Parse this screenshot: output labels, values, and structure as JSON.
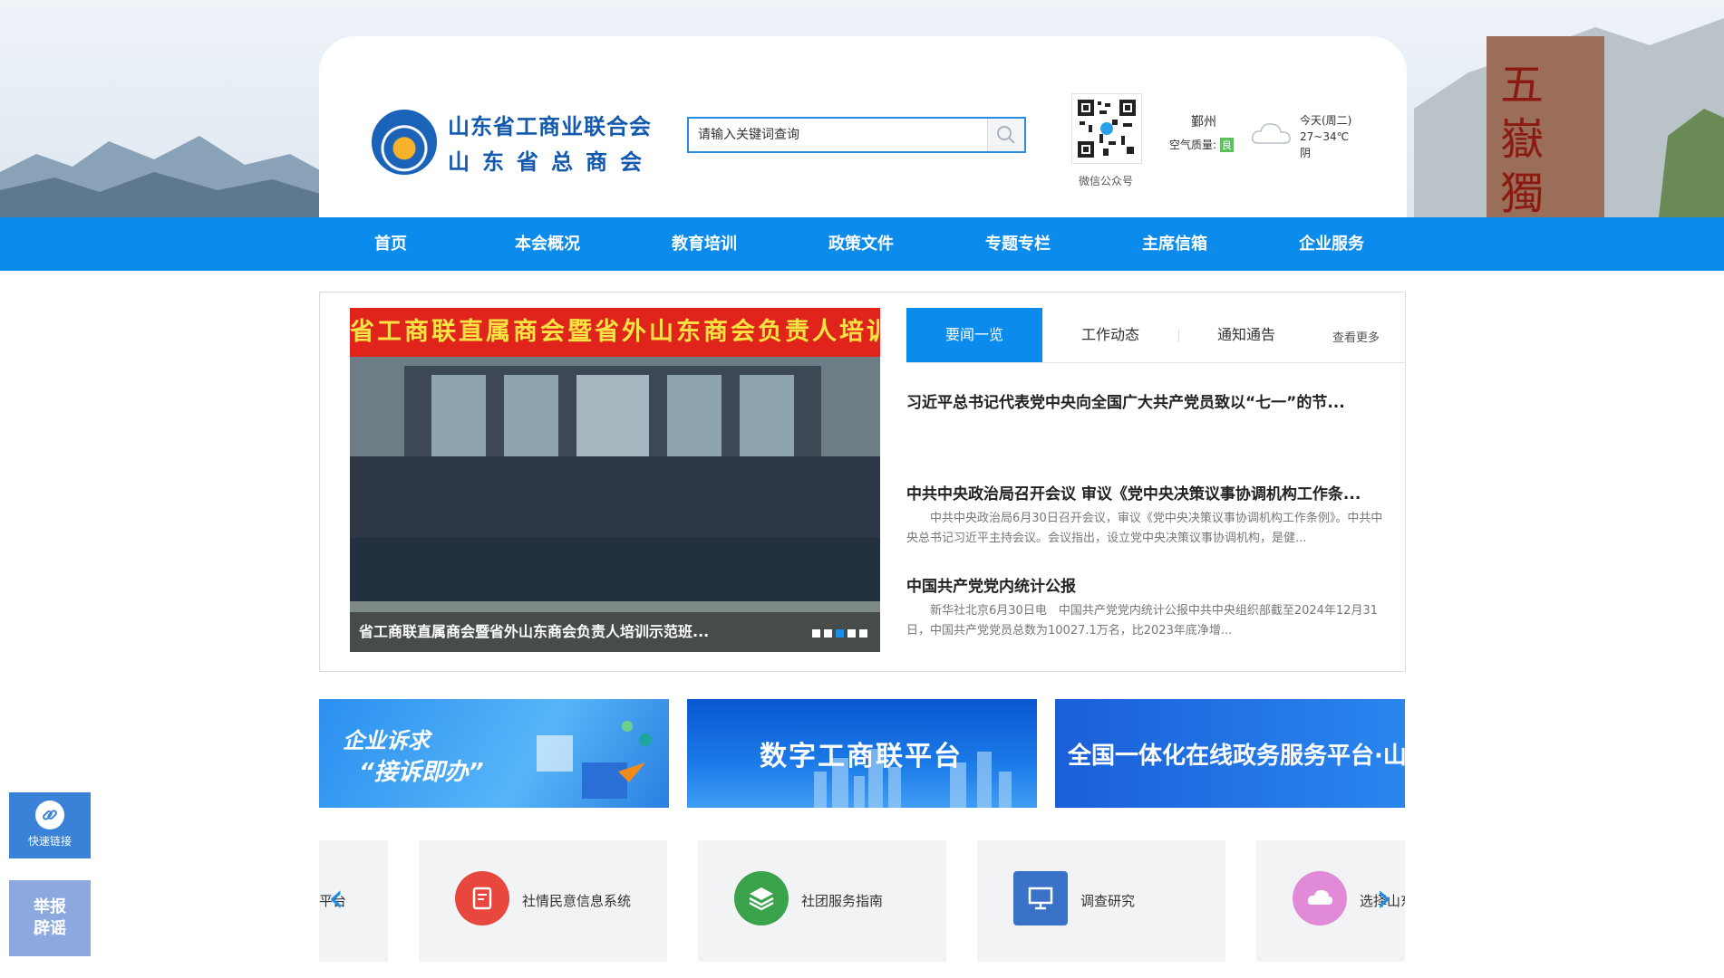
{
  "header": {
    "org_name_1": "山东省工商业联合会",
    "org_name_2": "山东省总商会",
    "search_placeholder": "请输入关键词查询",
    "qr_label": "微信公众号",
    "weather": {
      "city": "鄞州",
      "air_quality_label": "空气质量:",
      "air_quality_value": "良",
      "day": "今天(周二)",
      "temp": "27~34℃",
      "condition": "阴"
    }
  },
  "nav": {
    "items": [
      "首页",
      "本会概况",
      "教育培训",
      "政策文件",
      "专题专栏",
      "主席信箱",
      "企业服务"
    ]
  },
  "slider": {
    "banner_text": "省工商联直属商会暨省外山东商会负责人培训示",
    "caption": "省工商联直属商会暨省外山东商会负责人培训示范班..."
  },
  "tabs": {
    "items": [
      "要闻一览",
      "工作动态",
      "通知通告"
    ],
    "more": "查看更多"
  },
  "news": [
    {
      "title": "习近平总书记代表党中央向全国广大共产党员致以“七一”的节...",
      "summary": ""
    },
    {
      "title": "中共中央政治局召开会议 审议《党中央决策议事协调机构工作条...",
      "summary": "中共中央政治局6月30日召开会议，审议《党中央决策议事协调机构工作条例》。中共中央总书记习近平主持会议。会议指出，设立党中央决策议事协调机构，是健..."
    },
    {
      "title": "中国共产党党内统计公报",
      "summary": "新华社北京6月30日电　中国共产党党内统计公报中共中央组织部截至2024年12月31日，中国共产党党员总数为10027.1万名，比2023年底净增..."
    }
  ],
  "banners": {
    "b1_line1": "企业诉求",
    "b1_line2": "“接诉即办”",
    "b2": "数字工商联平台",
    "b3": "全国一体化在线政务服务平台·山东"
  },
  "services": {
    "partial_left": "平台",
    "items": [
      "社情民意信息系统",
      "社团服务指南",
      "调查研究"
    ],
    "partial_right": "选择山东"
  },
  "side": {
    "quick_link": "快速链接",
    "report_line1": "举报",
    "report_line2": "辟谣"
  },
  "colors": {
    "primary": "#0b8cec",
    "logo_blue": "#1359b0",
    "banner_red": "#e0241b"
  }
}
